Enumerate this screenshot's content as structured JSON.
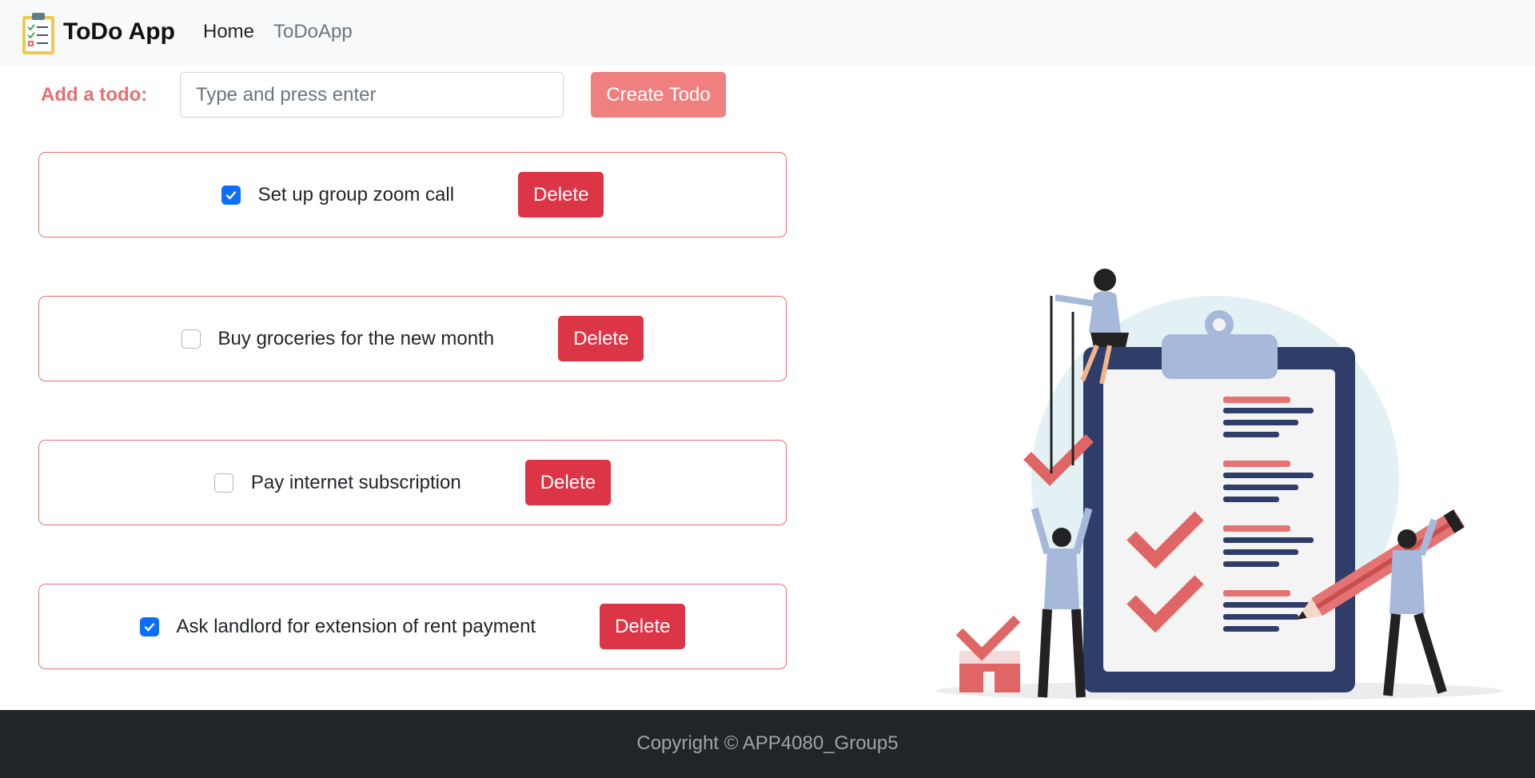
{
  "navbar": {
    "brand": "ToDo App",
    "links": [
      {
        "label": "Home"
      },
      {
        "label": "ToDoApp"
      }
    ]
  },
  "form": {
    "label": "Add a todo:",
    "placeholder": "Type and press enter",
    "value": "",
    "button_label": "Create Todo"
  },
  "todos": [
    {
      "text": "Set up group zoom call",
      "checked": true,
      "delete_label": "Delete"
    },
    {
      "text": "Buy groceries for the new month",
      "checked": false,
      "delete_label": "Delete"
    },
    {
      "text": "Pay internet subscription",
      "checked": false,
      "delete_label": "Delete"
    },
    {
      "text": "Ask landlord for extension of rent payment",
      "checked": true,
      "delete_label": "Delete"
    }
  ],
  "footer": {
    "text": "Copyright © APP4080_Group5"
  },
  "colors": {
    "accent": "#e76f6f",
    "create_button": "#f08080",
    "delete_button": "#dc3545",
    "checkbox_checked": "#0d6efd",
    "footer_bg": "#212529",
    "navbar_bg": "#f8f9fa"
  },
  "icons": {
    "brand": "clipboard-checklist-icon",
    "checkbox_checked": "checkmark-icon"
  }
}
